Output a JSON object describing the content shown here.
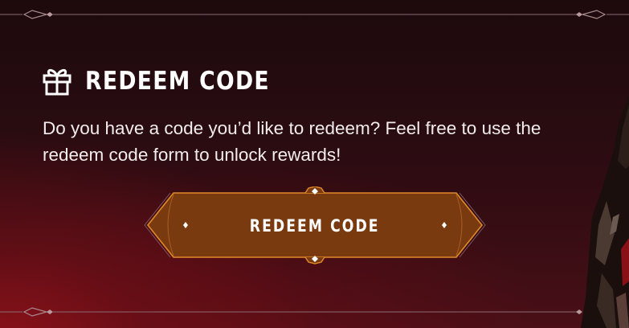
{
  "section": {
    "title": "REDEEM CODE",
    "icon": "gift-icon",
    "description": "Do you have a code you’d like to redeem? Feel free to use the redeem code form to unlock rewards!"
  },
  "button": {
    "label": "REDEEM CODE"
  },
  "colors": {
    "button_fill": "#7a3a0f",
    "button_border": "#e08a2a",
    "frame_line": "#8c6a70",
    "text": "#ffffff",
    "background": "#2a0c11"
  }
}
